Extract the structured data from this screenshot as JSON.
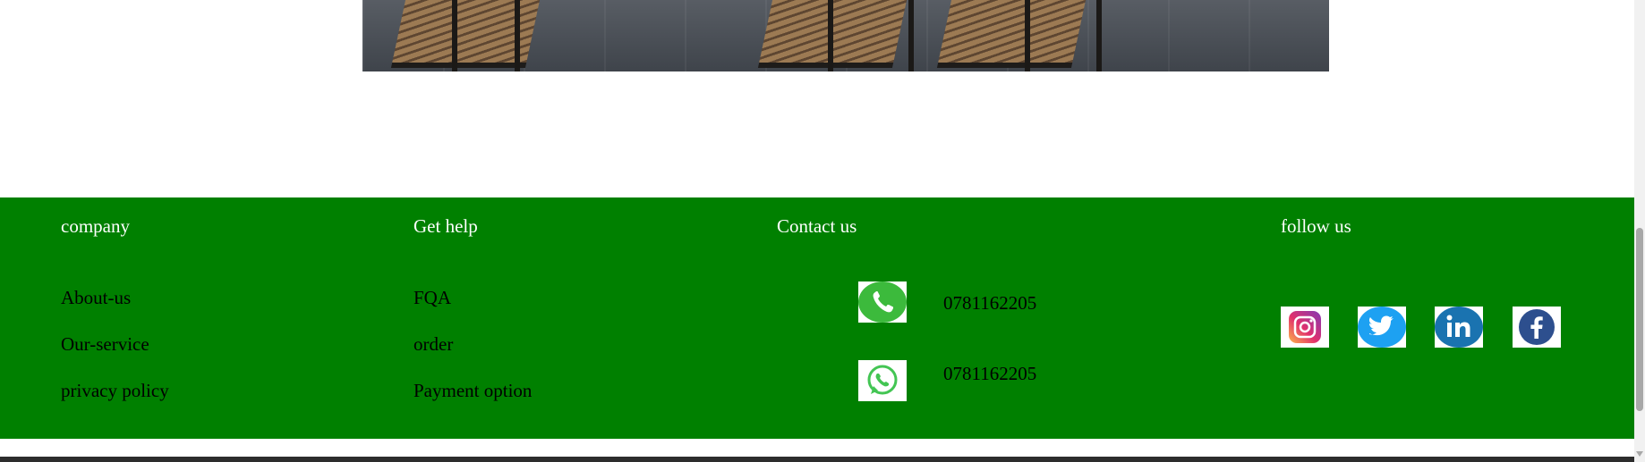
{
  "footer": {
    "company": {
      "title": "company",
      "links": [
        "About-us",
        "Our-service",
        "privacy policy"
      ]
    },
    "help": {
      "title": "Get help",
      "links": [
        "FQA",
        "order",
        "Payment option"
      ]
    },
    "contact": {
      "title": "Contact us",
      "phone": "0781162205",
      "whatsapp": "0781162205"
    },
    "follow": {
      "title": "follow us",
      "icons": [
        "instagram-icon",
        "twitter-icon",
        "linkedin-icon",
        "facebook-icon"
      ]
    }
  },
  "colors": {
    "footer_bg": "#008000",
    "phone_green": "#3cba3c",
    "whatsapp_green": "#43c553",
    "linkedin_blue": "#1a73b0",
    "facebook_blue": "#2d4f8e",
    "twitter_blue": "#1da1f2"
  }
}
